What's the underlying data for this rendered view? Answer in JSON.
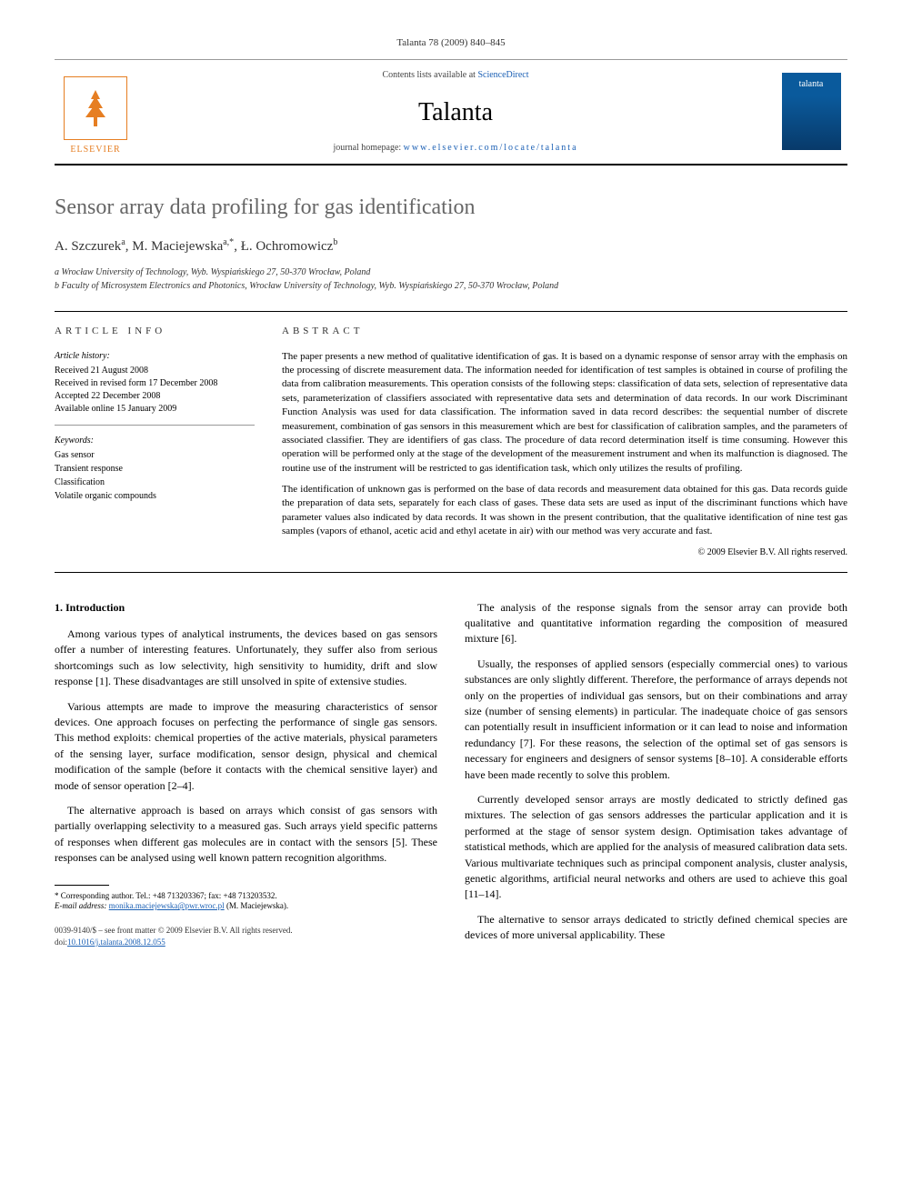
{
  "header": {
    "citation": "Talanta 78 (2009) 840–845"
  },
  "banner": {
    "contents_prefix": "Contents lists available at ",
    "contents_link": "ScienceDirect",
    "journal": "Talanta",
    "homepage_prefix": "journal homepage: ",
    "homepage_url": "www.elsevier.com/locate/talanta",
    "publisher": "ELSEVIER",
    "cover_label": "talanta"
  },
  "article": {
    "title": "Sensor array data profiling for gas identification",
    "authors_html": "A. Szczurek",
    "authors": [
      {
        "name": "A. Szczurek",
        "sup": "a"
      },
      {
        "name": "M. Maciejewska",
        "sup": "a,*"
      },
      {
        "name": "Ł. Ochromowicz",
        "sup": "b"
      }
    ],
    "affiliations": [
      "a Wrocław University of Technology, Wyb. Wyspiańskiego 27, 50-370 Wrocław, Poland",
      "b Faculty of Microsystem Electronics and Photonics, Wrocław University of Technology, Wyb. Wyspiańskiego 27, 50-370 Wrocław, Poland"
    ]
  },
  "info": {
    "heading": "ARTICLE INFO",
    "history_label": "Article history:",
    "history": [
      "Received 21 August 2008",
      "Received in revised form 17 December 2008",
      "Accepted 22 December 2008",
      "Available online 15 January 2009"
    ],
    "keywords_label": "Keywords:",
    "keywords": [
      "Gas sensor",
      "Transient response",
      "Classification",
      "Volatile organic compounds"
    ]
  },
  "abstract": {
    "heading": "ABSTRACT",
    "para1": "The paper presents a new method of qualitative identification of gas. It is based on a dynamic response of sensor array with the emphasis on the processing of discrete measurement data. The information needed for identification of test samples is obtained in course of profiling the data from calibration measurements. This operation consists of the following steps: classification of data sets, selection of representative data sets, parameterization of classifiers associated with representative data sets and determination of data records. In our work Discriminant Function Analysis was used for data classification. The information saved in data record describes: the sequential number of discrete measurement, combination of gas sensors in this measurement which are best for classification of calibration samples, and the parameters of associated classifier. They are identifiers of gas class. The procedure of data record determination itself is time consuming. However this operation will be performed only at the stage of the development of the measurement instrument and when its malfunction is diagnosed. The routine use of the instrument will be restricted to gas identification task, which only utilizes the results of profiling.",
    "para2": "The identification of unknown gas is performed on the base of data records and measurement data obtained for this gas. Data records guide the preparation of data sets, separately for each class of gases. These data sets are used as input of the discriminant functions which have parameter values also indicated by data records. It was shown in the present contribution, that the qualitative identification of nine test gas samples (vapors of ethanol, acetic acid and ethyl acetate in air) with our method was very accurate and fast.",
    "copyright": "© 2009 Elsevier B.V. All rights reserved."
  },
  "body": {
    "section1_heading": "1. Introduction",
    "col1": {
      "p1": "Among various types of analytical instruments, the devices based on gas sensors offer a number of interesting features. Unfortunately, they suffer also from serious shortcomings such as low selectivity, high sensitivity to humidity, drift and slow response [1]. These disadvantages are still unsolved in spite of extensive studies.",
      "p2": "Various attempts are made to improve the measuring characteristics of sensor devices. One approach focuses on perfecting the performance of single gas sensors. This method exploits: chemical properties of the active materials, physical parameters of the sensing layer, surface modification, sensor design, physical and chemical modification of the sample (before it contacts with the chemical sensitive layer) and mode of sensor operation [2–4].",
      "p3": "The alternative approach is based on arrays which consist of gas sensors with partially overlapping selectivity to a measured gas. Such arrays yield specific patterns of responses when different gas molecules are in contact with the sensors [5]. These responses can be analysed using well known pattern recognition algorithms."
    },
    "col2": {
      "p1": "The analysis of the response signals from the sensor array can provide both qualitative and quantitative information regarding the composition of measured mixture [6].",
      "p2": "Usually, the responses of applied sensors (especially commercial ones) to various substances are only slightly different. Therefore, the performance of arrays depends not only on the properties of individual gas sensors, but on their combinations and array size (number of sensing elements) in particular. The inadequate choice of gas sensors can potentially result in insufficient information or it can lead to noise and information redundancy [7]. For these reasons, the selection of the optimal set of gas sensors is necessary for engineers and designers of sensor systems [8–10]. A considerable efforts have been made recently to solve this problem.",
      "p3": "Currently developed sensor arrays are mostly dedicated to strictly defined gas mixtures. The selection of gas sensors addresses the particular application and it is performed at the stage of sensor system design. Optimisation takes advantage of statistical methods, which are applied for the analysis of measured calibration data sets. Various multivariate techniques such as principal component analysis, cluster analysis, genetic algorithms, artificial neural networks and others are used to achieve this goal [11–14].",
      "p4": "The alternative to sensor arrays dedicated to strictly defined chemical species are devices of more universal applicability. These"
    }
  },
  "footnotes": {
    "corr": "* Corresponding author. Tel.: +48 713203367; fax: +48 713203532.",
    "email_label": "E-mail address:",
    "email": "monika.maciejewska@pwr.wroc.pl",
    "email_person": "(M. Maciejewska)."
  },
  "bottom": {
    "issn": "0039-9140/$ – see front matter © 2009 Elsevier B.V. All rights reserved.",
    "doi_label": "doi:",
    "doi": "10.1016/j.talanta.2008.12.055"
  }
}
